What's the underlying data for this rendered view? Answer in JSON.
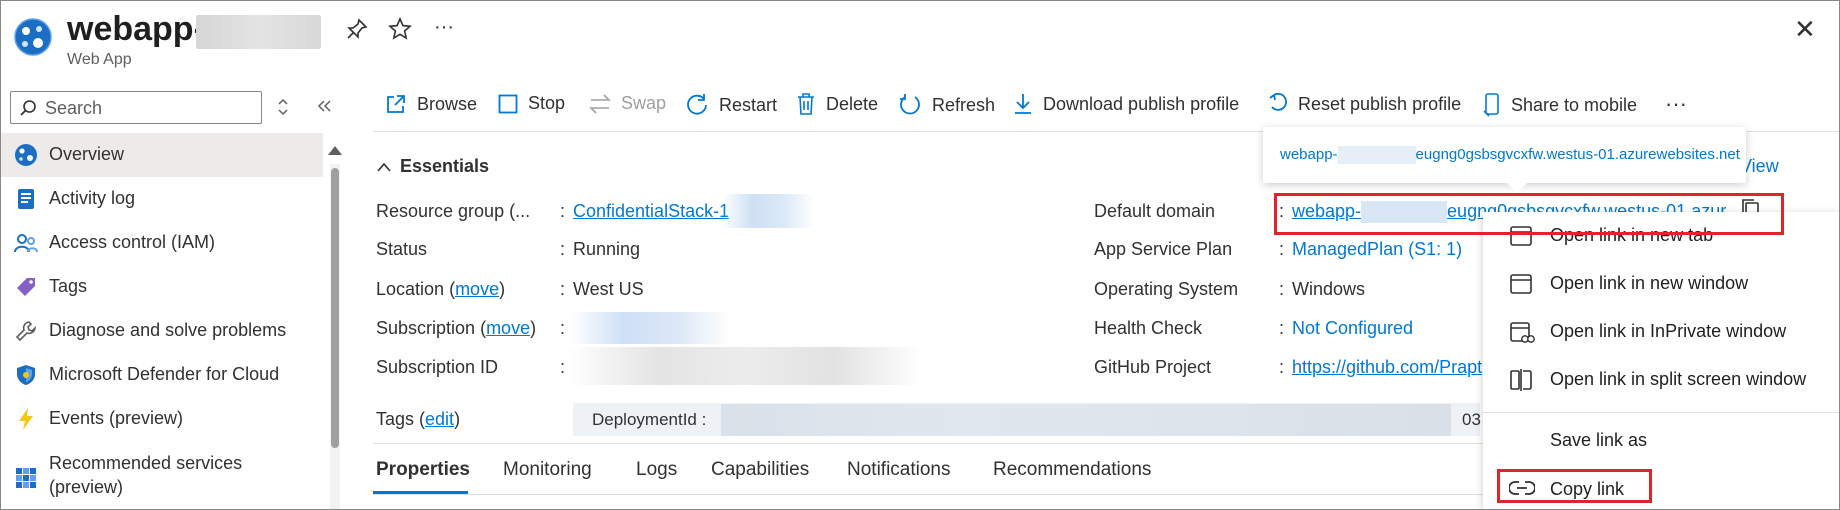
{
  "header": {
    "title": "webapp-",
    "subtitle": "Web App",
    "close_glyph": "✕"
  },
  "sidebar": {
    "search_placeholder": "Search",
    "items": [
      {
        "label": "Overview",
        "icon": "overview-icon",
        "active": true
      },
      {
        "label": "Activity log",
        "icon": "activity-log-icon"
      },
      {
        "label": "Access control (IAM)",
        "icon": "access-control-icon"
      },
      {
        "label": "Tags",
        "icon": "tag-icon"
      },
      {
        "label": "Diagnose and solve problems",
        "icon": "wrench-icon"
      },
      {
        "label": "Microsoft Defender for Cloud",
        "icon": "shield-icon"
      },
      {
        "label": "Events (preview)",
        "icon": "lightning-icon"
      },
      {
        "label": "Recommended services",
        "label2": "(preview)",
        "icon": "grid-icon"
      }
    ]
  },
  "toolbar": {
    "browse": "Browse",
    "stop": "Stop",
    "swap": "Swap",
    "restart": "Restart",
    "delete": "Delete",
    "refresh": "Refresh",
    "download": "Download publish profile",
    "reset": "Reset publish profile",
    "share": "Share to mobile",
    "more": "···"
  },
  "essentials": {
    "heading": "Essentials",
    "json_view_partial": "View",
    "left": {
      "resource_group_label": "Resource group (...",
      "resource_group_value": "ConfidentialStack-1",
      "status_label": "Status",
      "status_value": "Running",
      "location_label": "Location",
      "location_move": "move",
      "location_value": "West US",
      "subscription_label": "Subscription",
      "subscription_move": "move",
      "subscription_id_label": "Subscription ID",
      "tags_label": "Tags",
      "tags_edit": "edit",
      "tag_key": "DeploymentId :",
      "tag_tail": "03"
    },
    "right": {
      "default_domain_label": "Default domain",
      "default_domain_value_a": "webapp-",
      "default_domain_value_b": "eugng0gsbsgvcxfw.westus-01.azur",
      "app_service_plan_label": "App Service Plan",
      "app_service_plan_value": "ManagedPlan (S1: 1)",
      "os_label": "Operating System",
      "os_value": "Windows",
      "health_label": "Health Check",
      "health_value": "Not Configured",
      "github_label": "GitHub Project",
      "github_value": "https://github.com/Prapt"
    }
  },
  "tooltip": {
    "text_a": "webapp-",
    "text_b": "eugng0gsbsgvcxfw.westus-01.azurewebsites.net"
  },
  "context_menu": {
    "items": [
      {
        "label": "Open link in new tab",
        "icon": "new-tab-icon"
      },
      {
        "label": "Open link in new window",
        "icon": "new-window-icon"
      },
      {
        "label": "Open link in InPrivate window",
        "icon": "inprivate-icon"
      },
      {
        "label": "Open link in split screen window",
        "icon": "split-screen-icon"
      },
      {
        "label": "Save link as",
        "icon": ""
      },
      {
        "label": "Copy link",
        "icon": "link-icon"
      }
    ]
  },
  "tabs": [
    "Properties",
    "Monitoring",
    "Logs",
    "Capabilities",
    "Notifications",
    "Recommendations"
  ],
  "colors": {
    "accent": "#0078d4",
    "highlight_box": "#e0242a",
    "active_nav_bg": "#edebe9"
  }
}
